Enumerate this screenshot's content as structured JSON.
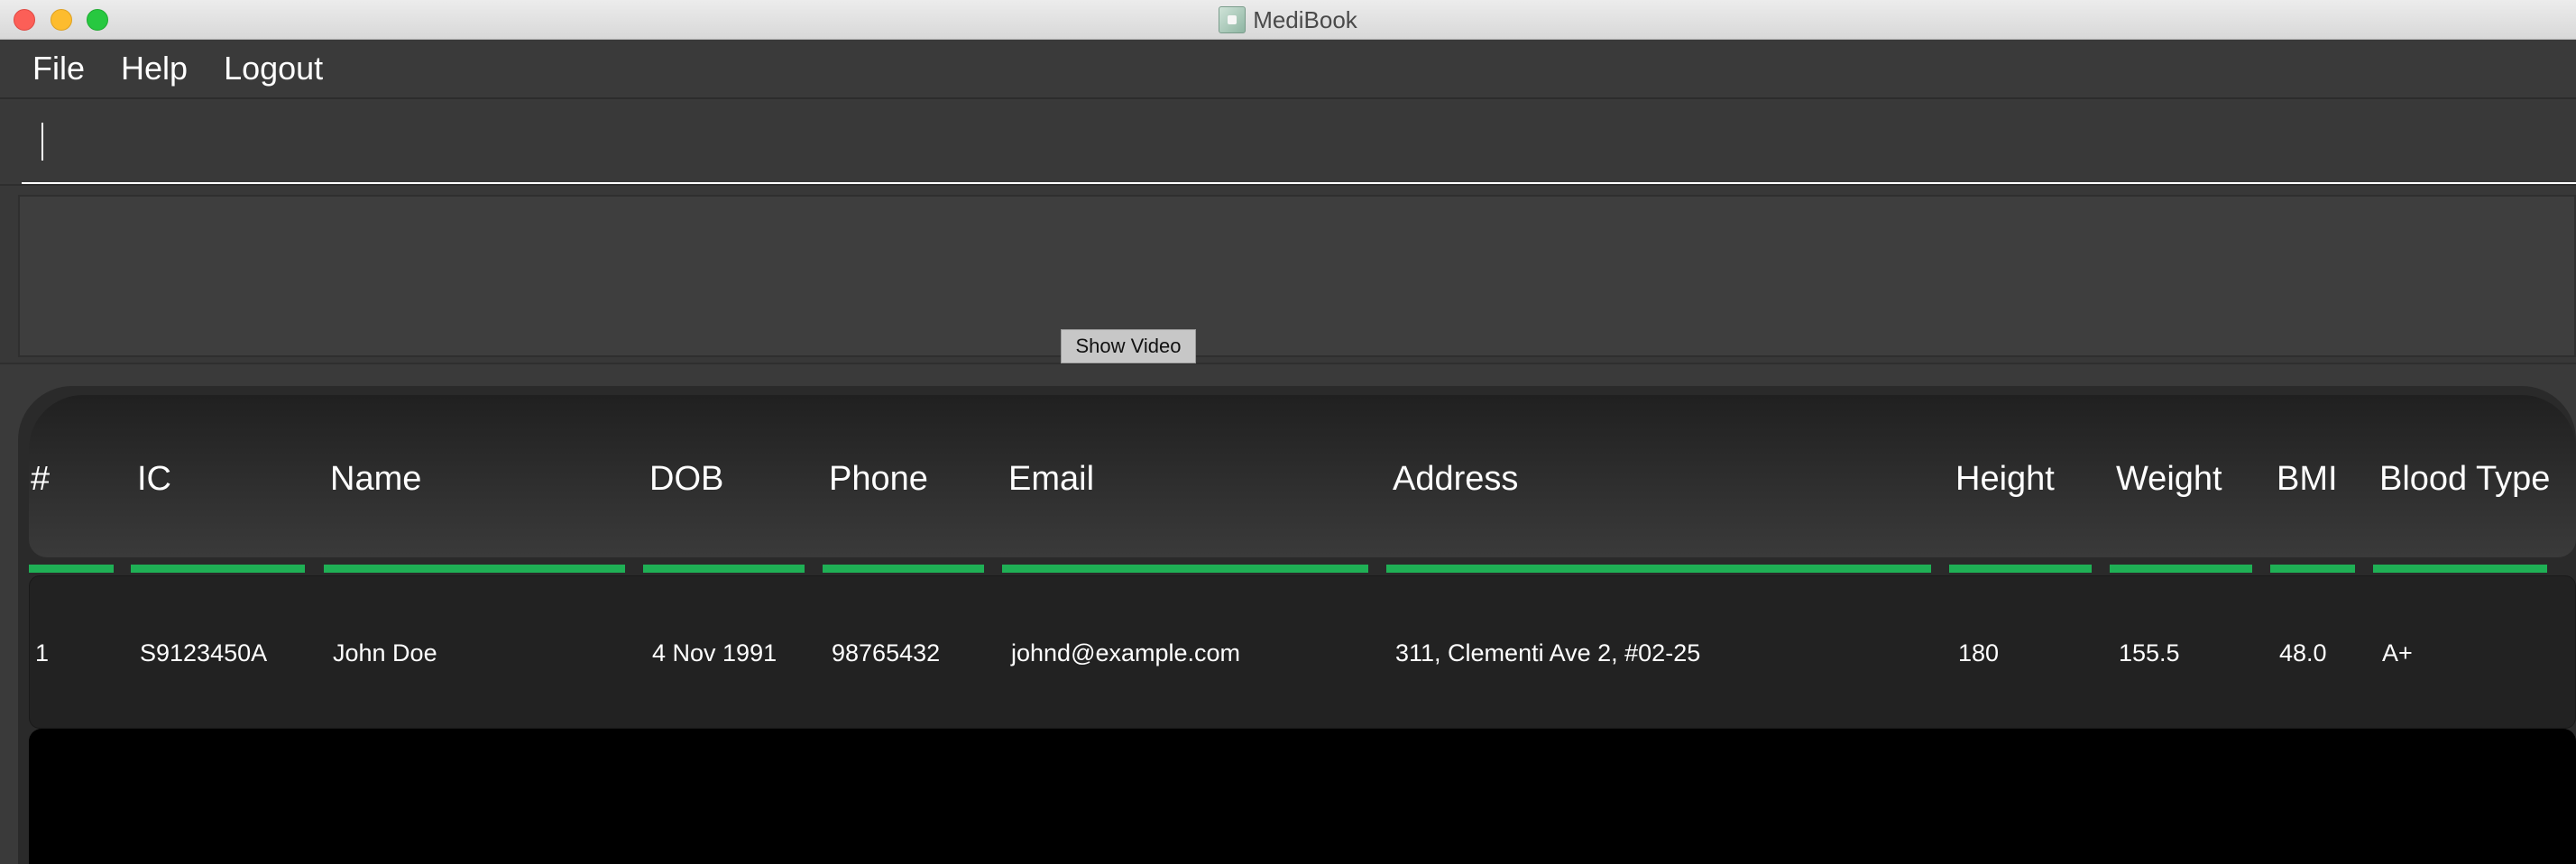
{
  "window": {
    "title": "MediBook",
    "traffic_colors": {
      "close": "#fc5f57",
      "minimize": "#fdbc2e",
      "maximize": "#27c840"
    }
  },
  "menu": {
    "file": "File",
    "help": "Help",
    "logout": "Logout"
  },
  "command": {
    "value": "",
    "placeholder": ""
  },
  "result": {
    "text": "",
    "show_video_label": "Show Video"
  },
  "table": {
    "accent_color": "#1fb055",
    "headers": [
      "#",
      "IC",
      "Name",
      "DOB",
      "Phone",
      "Email",
      "Address",
      "Height",
      "Weight",
      "BMI",
      "Blood Type"
    ],
    "rows": [
      [
        "1",
        "S9123450A",
        "John Doe",
        "4 Nov 1991",
        "98765432",
        "johnd@example.com",
        "311, Clementi Ave 2, #02-25",
        "180",
        "155.5",
        "48.0",
        "A+"
      ]
    ]
  }
}
